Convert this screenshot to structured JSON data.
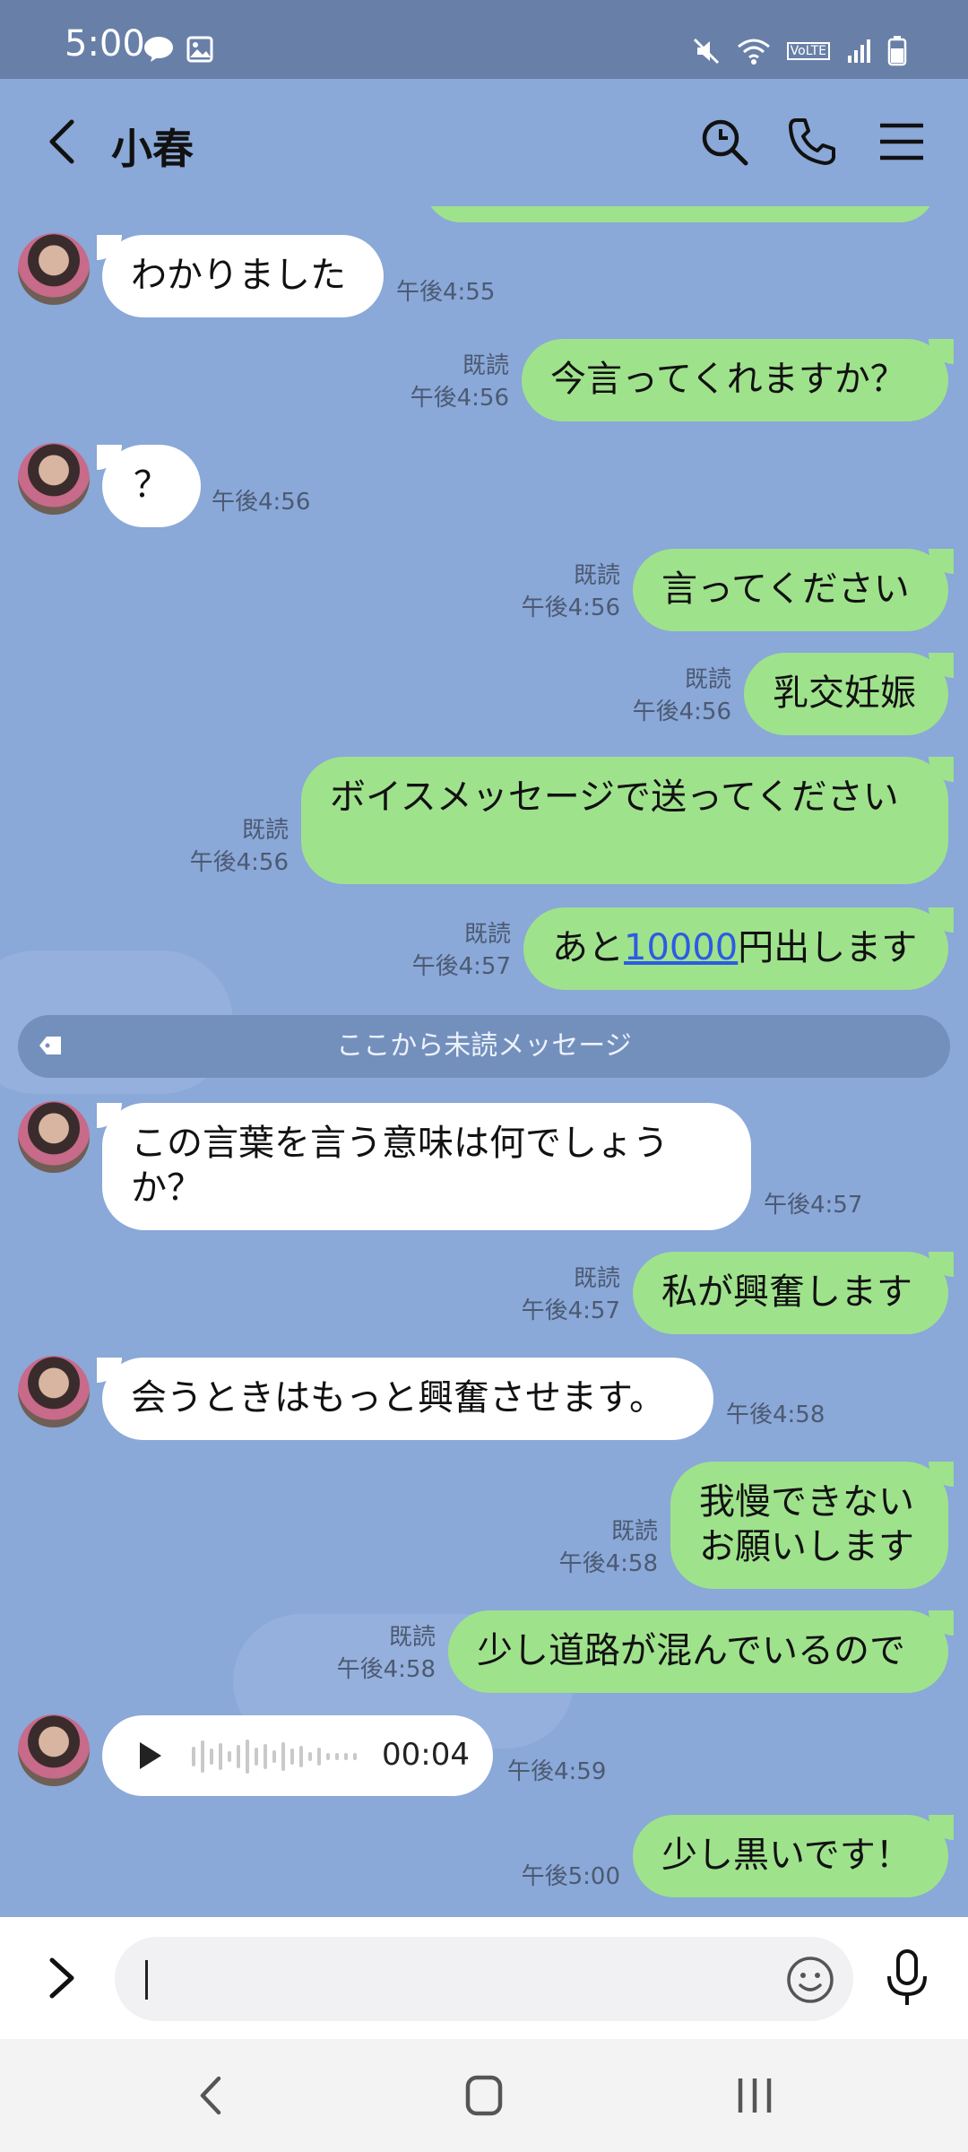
{
  "status_bar": {
    "time": "5:00",
    "volte_label": "VoLTE"
  },
  "header": {
    "title": "小春"
  },
  "messages": [
    {
      "text": "わかりました",
      "time": "午後4:55"
    },
    {
      "text": "今言ってくれますか？",
      "read": "既読",
      "time": "午後4:56"
    },
    {
      "text": "？",
      "time": "午後4:56"
    },
    {
      "text": "言ってください",
      "read": "既読",
      "time": "午後4:56"
    },
    {
      "text": "乳交妊娠",
      "read": "既読",
      "time": "午後4:56"
    },
    {
      "text": "ボイスメッセージで送ってください",
      "read": "既読",
      "time": "午後4:56"
    },
    {
      "text_before": "あと",
      "link": "10000",
      "text_after": "円出します",
      "read": "既読",
      "time": "午後4:57"
    },
    {
      "text": "この言葉を言う意味は何でしょうか？",
      "time": "午後4:57"
    },
    {
      "text": "私が興奮します",
      "read": "既読",
      "time": "午後4:57"
    },
    {
      "text": "会うときはもっと興奮させます。",
      "time": "午後4:58"
    },
    {
      "text": "我慢できない\nお願いします",
      "read": "既読",
      "time": "午後4:58"
    },
    {
      "text": "少し道路が混んでいるので",
      "read": "既読",
      "time": "午後4:58"
    },
    {
      "voice_duration": "00:04",
      "time": "午後4:59"
    },
    {
      "text": "少し黒いです！",
      "time": "午後5:00"
    }
  ],
  "unread_divider": "ここから未読メッセージ",
  "input": {
    "placeholder": ""
  }
}
